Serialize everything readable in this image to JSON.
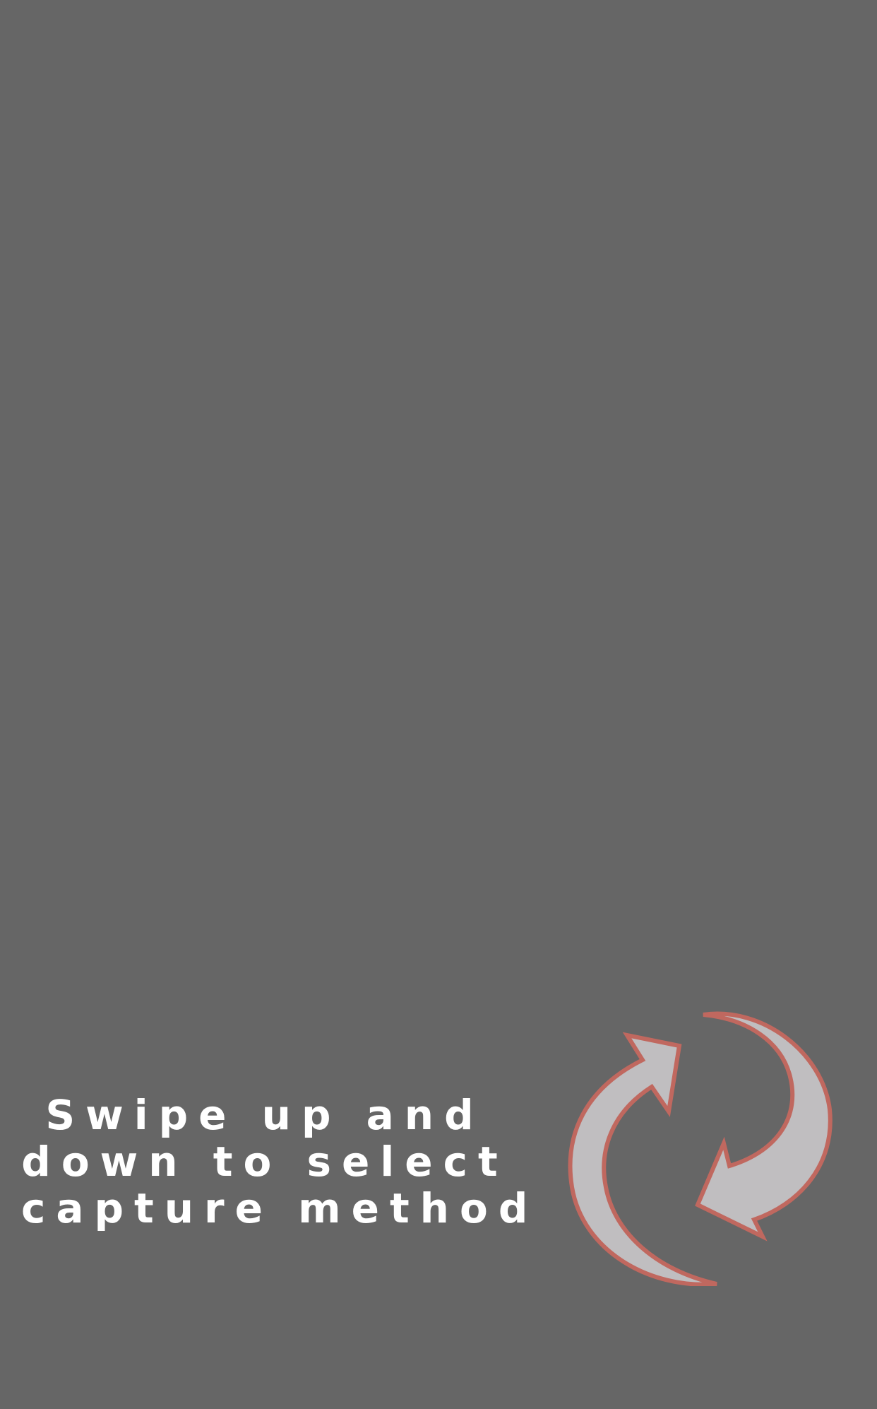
{
  "overlay": {
    "background_color": "#666666",
    "hint": {
      "lines": [
        "Swipe up and",
        "down to select",
        "capture method"
      ]
    },
    "swap_icon": {
      "name": "rotate-arrows-icon",
      "fill_color": "#c0bec0",
      "stroke_color": "#c0685f"
    }
  }
}
